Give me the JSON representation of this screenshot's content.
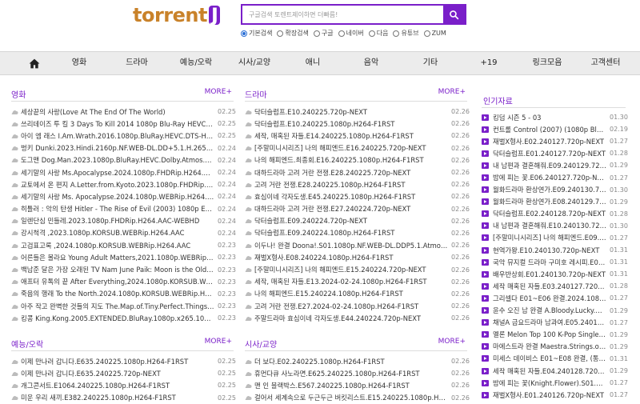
{
  "logo": {
    "part1": "torrent",
    "part2": "J"
  },
  "search": {
    "placeholder": "구글검색 토렌트제이하면 더빠름!"
  },
  "radios": [
    {
      "label": "기본검색",
      "checked": true
    },
    {
      "label": "확장검색",
      "checked": false
    },
    {
      "label": "구글",
      "checked": false
    },
    {
      "label": "네이버",
      "checked": false
    },
    {
      "label": "다음",
      "checked": false
    },
    {
      "label": "유튜브",
      "checked": false
    },
    {
      "label": "ZUM",
      "checked": false
    }
  ],
  "nav": [
    "영화",
    "드라마",
    "예능/오락",
    "시사/교양",
    "애니",
    "음악",
    "기타",
    "+19",
    "링크모음",
    "고객센터"
  ],
  "colors": {
    "accent": "#7a1fc9",
    "logo_text": "#c9822a"
  },
  "movies": {
    "title": "영화",
    "more": "MORE+",
    "items": [
      {
        "t": "세상끝의 사랑(Love At The End Of The World)",
        "d": "02.25"
      },
      {
        "t": "쓰리데이즈 투 킬 3 Days To Kill 2014 1080p Blu-Ray HEVC x265 10bit",
        "d": "02.25"
      },
      {
        "t": "아이 엠 래스 I.Am.Wrath.2016.1080p.BluRay.HEVC.DTS-HD.MA.5.1",
        "d": "02.25"
      },
      {
        "t": "벙키 Dunki.2023.Hindi.2160p.NF.WEB-DL.DD+5.1.H.265-TheBiscuitMan",
        "d": "02.24"
      },
      {
        "t": "도그맨 Dog.Man.2023.1080p.BluRay.HEVC.Dolby.Atmos.TrueHD.7.1",
        "d": "02.24"
      },
      {
        "t": "세기말의 사랑 Ms.Apocalypse.2024.1080p.FHDRip.H264.AAC-WEBHD",
        "d": "02.24"
      },
      {
        "t": "교토에서 온 편지 A.Letter.from.Kyoto.2023.1080p.FHDRip.H264.AAC",
        "d": "02.24"
      },
      {
        "t": "세기말의 사랑 Ms. Apocalypse.2024.1080p.WEBRip.H264.AAC",
        "d": "02.24"
      },
      {
        "t": "히틀러 : 악의 탄생 Hitler - The Rise of Evil (2003) 1080p ENG-KOR",
        "d": "02.24"
      },
      {
        "t": "일렌단심 민들레.2023.1080p.FHDRip.H264.AAC-WEBHD",
        "d": "02.24"
      },
      {
        "t": "강시척격 ,2023.1080p.KORSUB.WEBRip.H264.AAC",
        "d": "02.24"
      },
      {
        "t": "고검표고록 ,2024.1080p.KORSUB.WEBRip.H264.AAC",
        "d": "02.23"
      },
      {
        "t": "어른들은 몰라요 Young Adult Matters,2021.1080p.WEBRip.H264.AAC",
        "d": "02.23"
      },
      {
        "t": "백남준 달은 가장 오래된 TV Nam June Paik: Moon is the Oldest TV",
        "d": "02.23"
      },
      {
        "t": "애프터 유톡의 끝 After Everything,2024.1080p.KORSUB.WEBRip.H264",
        "d": "02.23"
      },
      {
        "t": "죽음의 행래 To the North.2024.1080p.KORSUB.WEBRip.H264.AAC",
        "d": "02.23"
      },
      {
        "t": "아주 작고 완벽한 것들의 지도 The.Map.of.Tiny.Perfect.Things.2021",
        "d": "02.23"
      },
      {
        "t": "킹콩 King.Kong.2005.EXTENDED.BluRay.1080p.x265.10bit.AAC-HDR",
        "d": "02.23"
      }
    ]
  },
  "dramas": {
    "title": "드라마",
    "more": "MORE+",
    "items": [
      {
        "t": "닥터슬럼프.E10.240225.720p-NEXT",
        "d": "02.26"
      },
      {
        "t": "닥터슬럼프.E10.240225.1080p.H264-F1RST",
        "d": "02.26"
      },
      {
        "t": "세작, 매혹된 자들.E14.240225.1080p.H264-F1RST",
        "d": "02.26"
      },
      {
        "t": "[주말미니시리즈] 나의 해피엔드.E16.240225.720p-NEXT",
        "d": "02.26"
      },
      {
        "t": "나의 해피엔드.최종회.E16.240225.1080p.H264-F1RST",
        "d": "02.26"
      },
      {
        "t": "대하드라마 고려 거란 전쟁.E28.240225.720p-NEXT",
        "d": "02.26"
      },
      {
        "t": "고려 거란 전쟁.E28.240225.1080p.H264-F1RST",
        "d": "02.26"
      },
      {
        "t": "효심이네 각자도생.E45.240225.1080p.H264-F1RST",
        "d": "02.26"
      },
      {
        "t": "대하드라마 고려 거란 전쟁.E27.240224.720p-NEXT",
        "d": "02.26"
      },
      {
        "t": "닥터슬럼프.E09.240224.720p-NEXT",
        "d": "02.26"
      },
      {
        "t": "닥터슬럼프.E09.240224.1080p.H264-F1RST",
        "d": "02.26"
      },
      {
        "t": "이두나! 완결 Doona!.S01.1080p.NF.WEB-DL.DDP5.1.Atmos.x264-ADWeb",
        "d": "02.26"
      },
      {
        "t": "재벌X형사.E08.240224.1080p.H264-F1RST",
        "d": "02.26"
      },
      {
        "t": "[주말미니시리즈] 나의 해피엔드.E15.240224.720p-NEXT",
        "d": "02.26"
      },
      {
        "t": "세작, 매혹된 자들.E13.2024-02-24.1080p.H264-F1RST",
        "d": "02.26"
      },
      {
        "t": "나의 해피엔드.E15.240224.1080p.H264-F1RST",
        "d": "02.26"
      },
      {
        "t": "고려 거란 전쟁.E27.2024-02-24.1080p.H264-F1RST",
        "d": "02.26"
      },
      {
        "t": "주말드라마 효심이네 각자도생.E44.240224.720p-NEXT",
        "d": "02.26"
      }
    ]
  },
  "variety": {
    "title": "예능/오락",
    "more": "MORE+",
    "items": [
      {
        "t": "이제 만나러 갑니다.E635.240225.1080p.H264-F1RST",
        "d": "02.25"
      },
      {
        "t": "이제 만나러 갑니다.E635.240225.720p-NEXT",
        "d": "02.25"
      },
      {
        "t": "개그콘서트.E1064.240225.1080p.H264-F1RST",
        "d": "02.25"
      },
      {
        "t": "미운 우리 새끼.E382.240225.1080p.H264-F1RST",
        "d": "02.25"
      }
    ]
  },
  "docs": {
    "title": "시사/교양",
    "more": "MORE+",
    "items": [
      {
        "t": "더 보다.E02.240225.1080p.H264-F1RST",
        "d": "02.26"
      },
      {
        "t": "휴먼다큐 사노라면.E625.240225.1080p.H264-F1RST",
        "d": "02.26"
      },
      {
        "t": "맨 인 블랙박스.E567.240225.1080p.H264-F1RST",
        "d": "02.26"
      },
      {
        "t": "걸어서 세계속으로 두근두근 버킷리스트.E15.240225.1080p.H264",
        "d": "02.26"
      }
    ]
  },
  "popular": {
    "title": "인기자료",
    "items": [
      {
        "t": "킹덤 시즌 5 - 03",
        "d": "01.30"
      },
      {
        "t": "컨트롤 Control (2007) (1080p BluRay x265 10bit)",
        "d": "02.19"
      },
      {
        "t": "재벌X형사.E02.240127.720p-NEXT",
        "d": "01.27"
      },
      {
        "t": "닥터슬럼프.E01.240127.720p-NEXT",
        "d": "01.28"
      },
      {
        "t": "내 남편과 결혼해줘.E09.240129.720p-NEXT",
        "d": "01.29"
      },
      {
        "t": "밤에 피는 꽃.E06.240127.720p-NEXT",
        "d": "01.27"
      },
      {
        "t": "월화드라마 환상연가.E09.240130.720p-NEXT",
        "d": "01.30"
      },
      {
        "t": "월화드라마 환상연가.E08.240129.720p-NEXT",
        "d": "01.29"
      },
      {
        "t": "닥터슬럼프.E02.240128.720p-NEXT",
        "d": "01.28"
      },
      {
        "t": "내 남편과 결혼해줘.E10.240130.720p-NEXT",
        "d": "01.30"
      },
      {
        "t": "[주말미니시리즈] 나의 해피엔드.E09.240127.720p",
        "d": "01.27"
      },
      {
        "t": "현역가왕.E10.240130.720p-NEXT",
        "d": "01.31"
      },
      {
        "t": "국악 뮤지컬 드라마 구미호 레시피.E01~E04 완결",
        "d": "01.31"
      },
      {
        "t": "배우반상회.E01.240130.720p-NEXT",
        "d": "01.31"
      },
      {
        "t": "세작 매혹된 자들.E03.240127.720p-NEXT",
        "d": "01.28"
      },
      {
        "t": "그리셀다 E01~E06 완결.2024.1080p",
        "d": "01.27"
      },
      {
        "t": "윤수 오진 남 완결 A.Bloody.Lucky.Day.E01-E10",
        "d": "01.29"
      },
      {
        "t": "채널A 금요드라마 남과여.E05.240126.720p-NEXT",
        "d": "01.27"
      },
      {
        "t": "멜론 Melon Top 100 K-Pop Singles Chart",
        "d": "01.29"
      },
      {
        "t": "마에스트라 완결 Maestra.Strings.of.Truth.E01-E12",
        "d": "01.29"
      },
      {
        "t": "미세스 데이비스 E01~E08 완결, (통합자막)",
        "d": "01.31"
      },
      {
        "t": "세작 매혹된 자들.E04.240128.720p-NEXT",
        "d": "01.29"
      },
      {
        "t": "밤에 피는 꽃(Knight.Flower).S01.E05.240126",
        "d": "01.27"
      },
      {
        "t": "재벌X형사.E01.240126.720p-NEXT",
        "d": "01.27"
      }
    ]
  }
}
